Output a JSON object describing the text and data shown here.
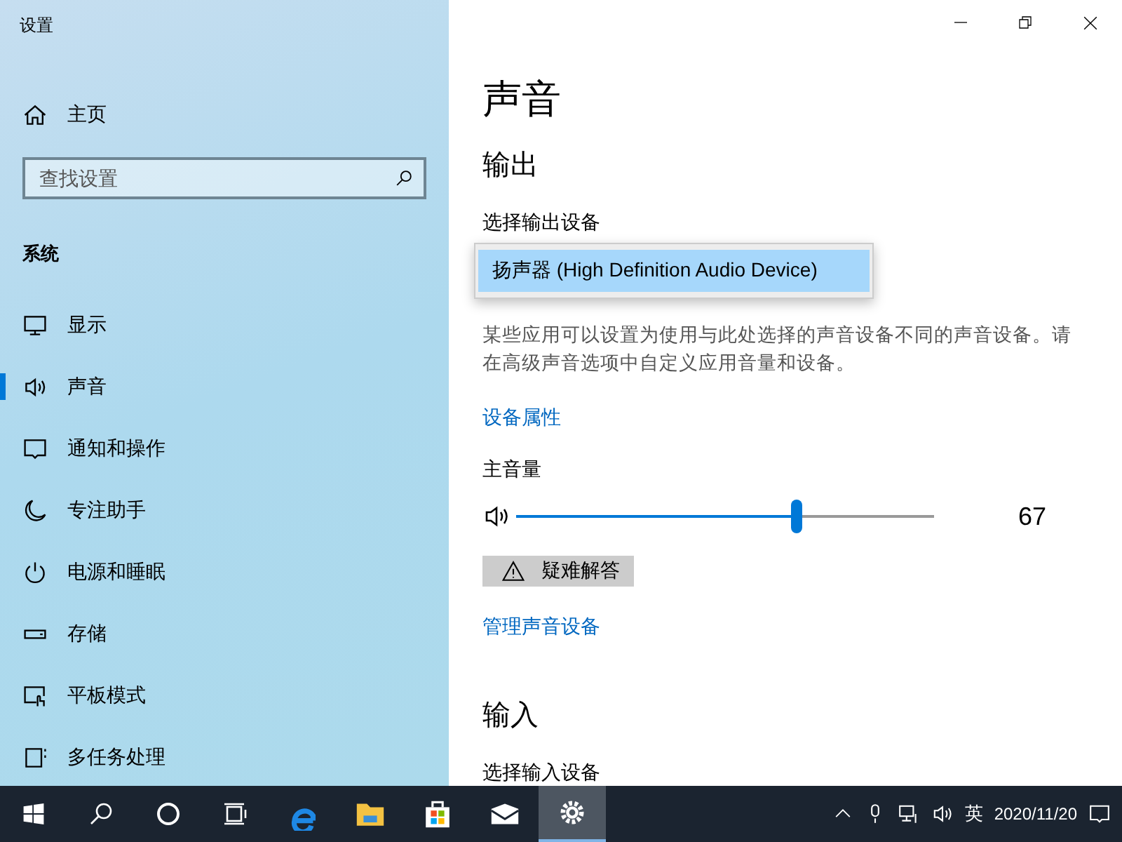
{
  "window": {
    "title": "设置"
  },
  "sidebar": {
    "home": {
      "label": "主页"
    },
    "search": {
      "placeholder": "查找设置"
    },
    "section": "系统",
    "items": [
      {
        "kind": "display",
        "label": "显示",
        "selected": false
      },
      {
        "kind": "sound",
        "label": "声音",
        "selected": true
      },
      {
        "kind": "notifications",
        "label": "通知和操作",
        "selected": false
      },
      {
        "kind": "focus",
        "label": "专注助手",
        "selected": false
      },
      {
        "kind": "power",
        "label": "电源和睡眠",
        "selected": false
      },
      {
        "kind": "storage",
        "label": "存储",
        "selected": false
      },
      {
        "kind": "tablet",
        "label": "平板模式",
        "selected": false
      },
      {
        "kind": "multitask",
        "label": "多任务处理",
        "selected": false
      }
    ]
  },
  "content": {
    "title": "声音",
    "output": {
      "heading": "输出",
      "device_label": "选择输出设备",
      "device_options": [
        {
          "label": "扬声器 (High Definition Audio Device)",
          "selected": true
        }
      ],
      "description": "某些应用可以设置为使用与此处选择的声音设备不同的声音设备。请在高级声音选项中自定义应用音量和设备。",
      "properties_link": "设备属性",
      "volume_label": "主音量",
      "volume": {
        "level": 0.67,
        "reading": "67"
      },
      "troubleshoot_button": "疑难解答",
      "manage_link": "管理声音设备"
    },
    "input": {
      "heading": "输入",
      "device_label": "选择输入设备"
    }
  },
  "taskbar": {
    "items": [
      {
        "kind": "start",
        "selected": false
      },
      {
        "kind": "search",
        "selected": false
      },
      {
        "kind": "cortana",
        "selected": false
      },
      {
        "kind": "taskview",
        "selected": false
      },
      {
        "kind": "edge",
        "selected": false
      },
      {
        "kind": "explorer",
        "selected": false
      },
      {
        "kind": "store",
        "selected": false
      },
      {
        "kind": "mail",
        "selected": false
      },
      {
        "kind": "settings",
        "selected": true
      }
    ],
    "language": "英",
    "date": "2020/11/20"
  }
}
